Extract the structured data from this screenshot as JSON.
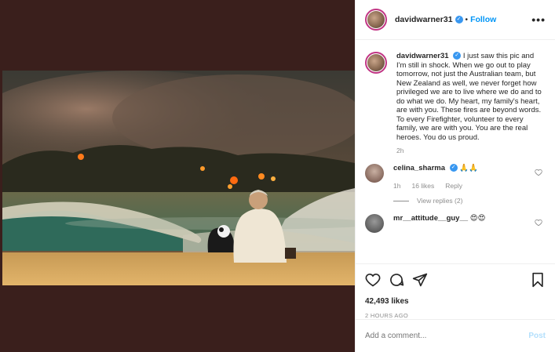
{
  "post": {
    "username": "davidwarner31",
    "follow_label": "Follow",
    "more_label": "•••"
  },
  "caption": {
    "username": "davidwarner31",
    "text": "I just saw this pic and I'm still in shock. When we go out to play tomorrow, not just the Australian team, but New Zealand as well, we never forget how privileged we are to live where we do and to do what we do. My heart, my family's heart, are with you. These fires are beyond words. To every Firefighter, volunteer to every family, we are with you. You are the real heroes. You do us proud.",
    "time": "2h"
  },
  "comments": [
    {
      "username": "celina_sharma",
      "text": "🙏🙏",
      "time": "1h",
      "likes": "16 likes",
      "reply_label": "Reply",
      "view_replies": "View replies (2)"
    },
    {
      "username": "mr__attitude__guy__",
      "text": "😍😍"
    }
  ],
  "stats": {
    "likes": "42,493 likes",
    "time": "2 HOURS AGO"
  },
  "composer": {
    "placeholder": "Add a comment...",
    "post_label": "Post"
  },
  "colors": {
    "background": "#3a1f1c",
    "link": "#0095f6",
    "verified": "#3897f0",
    "muted": "#8e8e8e"
  },
  "icons": [
    "more-icon",
    "heart-icon",
    "comment-icon",
    "share-icon",
    "bookmark-icon",
    "verified-icon"
  ]
}
